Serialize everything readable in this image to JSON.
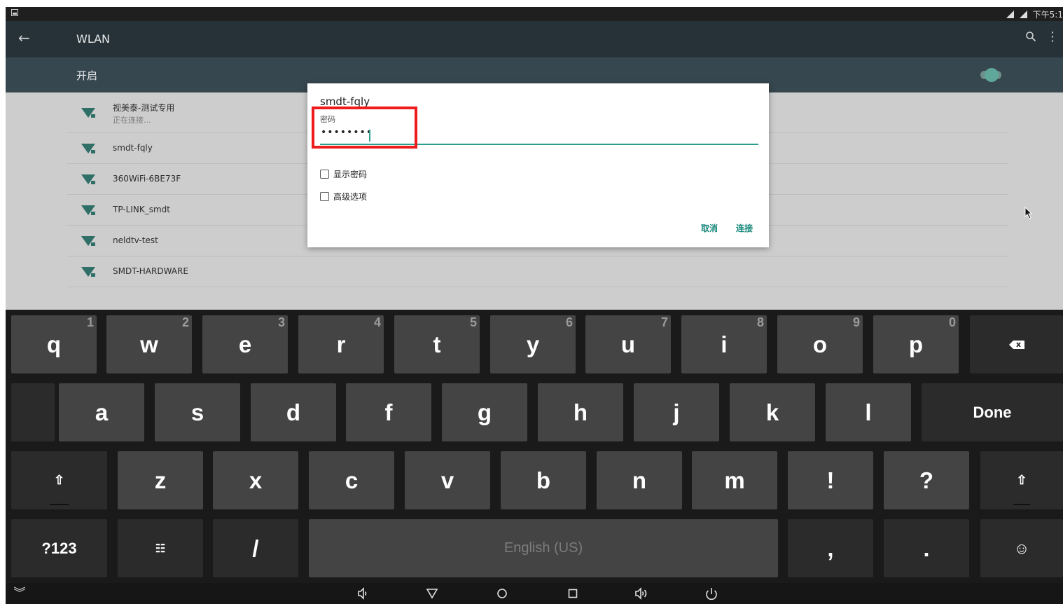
{
  "status_bar": {
    "time": "下午5:1"
  },
  "action_bar": {
    "title": "WLAN"
  },
  "wlan_switch": {
    "label": "开启",
    "on": true
  },
  "networks": [
    {
      "name": "视美泰-测试专用",
      "status": "正在连接..."
    },
    {
      "name": "smdt-fqly",
      "status": ""
    },
    {
      "name": "360WiFi-6BE73F",
      "status": ""
    },
    {
      "name": "TP-LINK_smdt",
      "status": ""
    },
    {
      "name": "neldtv-test",
      "status": ""
    },
    {
      "name": "SMDT-HARDWARE",
      "status": ""
    }
  ],
  "dialog": {
    "title": "smdt-fqly",
    "password_label": "密码",
    "password_value": "••••••••",
    "show_password_label": "显示密码",
    "advanced_label": "高级选项",
    "cancel_label": "取消",
    "connect_label": "连接"
  },
  "keyboard": {
    "row1": [
      {
        "label": "q",
        "hint": "1"
      },
      {
        "label": "w",
        "hint": "2"
      },
      {
        "label": "e",
        "hint": "3"
      },
      {
        "label": "r",
        "hint": "4"
      },
      {
        "label": "t",
        "hint": "5"
      },
      {
        "label": "y",
        "hint": "6"
      },
      {
        "label": "u",
        "hint": "7"
      },
      {
        "label": "i",
        "hint": "8"
      },
      {
        "label": "o",
        "hint": "9"
      },
      {
        "label": "p",
        "hint": "0"
      }
    ],
    "row2": [
      "a",
      "s",
      "d",
      "f",
      "g",
      "h",
      "j",
      "k",
      "l"
    ],
    "row3": [
      "z",
      "x",
      "c",
      "v",
      "b",
      "n",
      "m",
      "!",
      "?"
    ],
    "done_label": "Done",
    "symbols_label": "?123",
    "slash_label": "/",
    "space_label": "English (US)",
    "comma_label": ",",
    "period_label": ".",
    "shift_icon": "⇧",
    "emoji_icon": "☺",
    "settings_icon": "☷",
    "backspace_icon": "backspace-icon"
  },
  "nav_bar": {
    "icons": [
      "hide-keyboard-icon",
      "volume-down-icon",
      "back-icon",
      "home-icon",
      "recents-icon",
      "volume-up-icon",
      "power-icon"
    ]
  },
  "colors": {
    "accent": "#18877b",
    "highlight": "#ee1c1c",
    "actionbar": "#263238",
    "switchbar": "#37474f"
  }
}
